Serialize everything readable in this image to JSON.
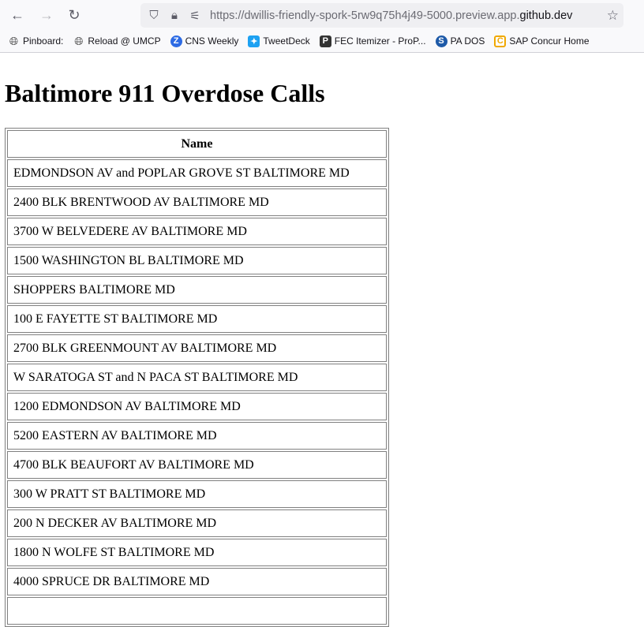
{
  "browser": {
    "url_gray": "https://dwillis-friendly-spork-5rw9q75h4j49-5000.preview.app.",
    "url_dark": "github.dev",
    "bookmarks": [
      {
        "label": "Pinboard:",
        "icon": "globe-icon"
      },
      {
        "label": "Reload @ UMCP",
        "icon": "globe-icon"
      },
      {
        "label": "CNS Weekly",
        "icon": "z-icon"
      },
      {
        "label": "TweetDeck",
        "icon": "tweetdeck-icon"
      },
      {
        "label": "FEC Itemizer - ProP...",
        "icon": "propublica-icon"
      },
      {
        "label": "PA DOS",
        "icon": "pados-icon"
      },
      {
        "label": "SAP Concur Home",
        "icon": "concur-icon"
      }
    ]
  },
  "page": {
    "title": "Baltimore 911 Overdose Calls",
    "table": {
      "header": "Name",
      "rows": [
        "EDMONDSON AV and POPLAR GROVE ST BALTIMORE MD",
        "2400 BLK BRENTWOOD AV BALTIMORE MD",
        "3700 W BELVEDERE AV BALTIMORE MD",
        "1500 WASHINGTON BL BALTIMORE MD",
        "SHOPPERS BALTIMORE MD",
        "100 E FAYETTE ST BALTIMORE MD",
        "2700 BLK GREENMOUNT AV BALTIMORE MD",
        "W SARATOGA ST and N PACA ST BALTIMORE MD",
        "1200 EDMONDSON AV BALTIMORE MD",
        "5200 EASTERN AV BALTIMORE MD",
        "4700 BLK BEAUFORT AV BALTIMORE MD",
        "300 W PRATT ST BALTIMORE MD",
        "200 N DECKER AV BALTIMORE MD",
        "1800 N WOLFE ST BALTIMORE MD",
        "4000 SPRUCE DR BALTIMORE MD",
        ""
      ]
    }
  }
}
